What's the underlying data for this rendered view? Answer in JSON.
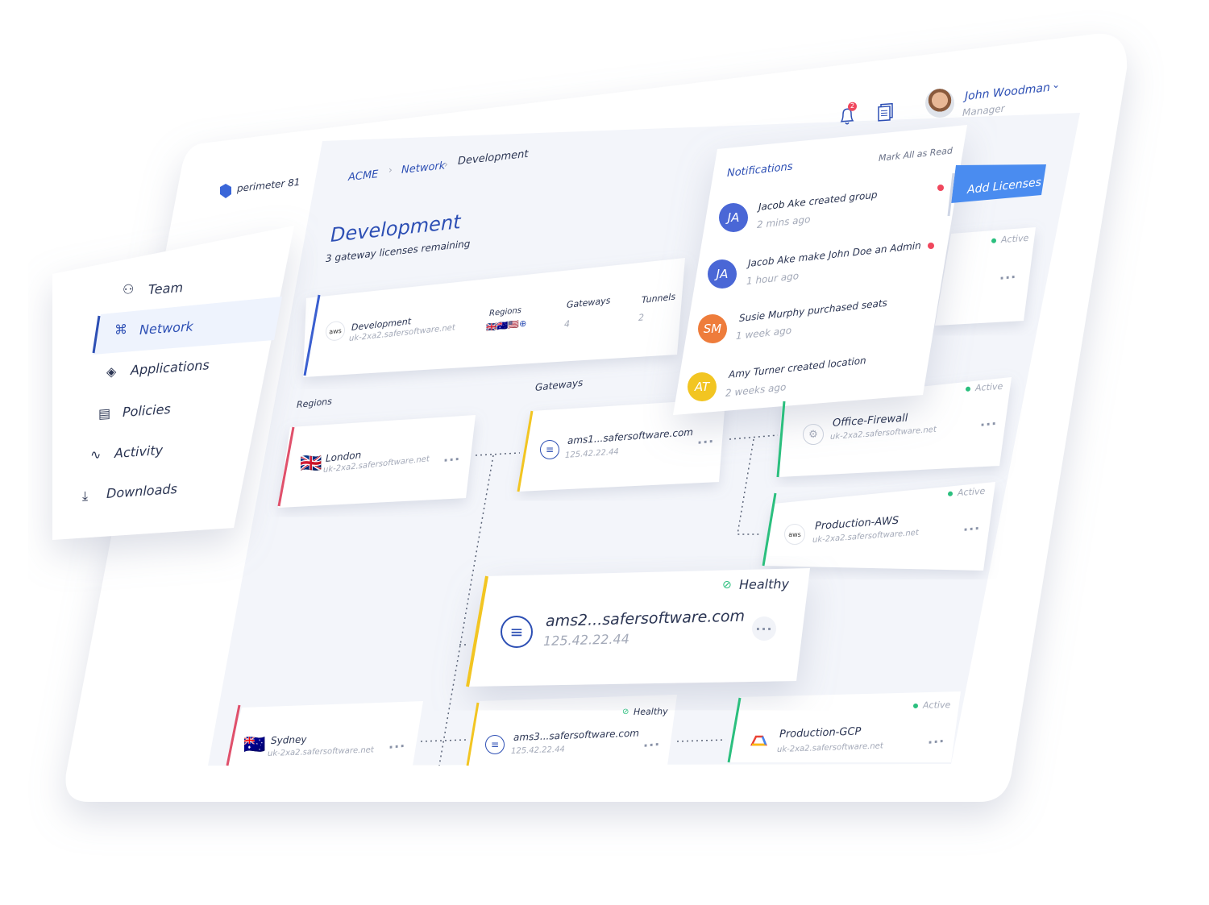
{
  "header": {
    "user_name": "John Woodman",
    "user_role": "Manager",
    "notification_count": "2"
  },
  "logo": "perimeter 81",
  "breadcrumb": [
    "ACME",
    "Network",
    "Development"
  ],
  "page": {
    "title": "Development",
    "subtitle": "3 gateway licenses remaining",
    "add_button": "Add Licenses"
  },
  "sidebar": {
    "items": [
      {
        "label": "Team",
        "icon": "team-icon"
      },
      {
        "label": "Network",
        "icon": "network-icon",
        "active": true
      },
      {
        "label": "Applications",
        "icon": "layers-icon"
      },
      {
        "label": "Policies",
        "icon": "policies-icon"
      },
      {
        "label": "Activity",
        "icon": "activity-icon"
      },
      {
        "label": "Downloads",
        "icon": "download-icon"
      }
    ]
  },
  "summary": {
    "name": "Development",
    "host": "uk-2xa2.safersoftware.net",
    "provider": "aws",
    "regions_label": "Regions",
    "gateways_label": "Gateways",
    "gateways": "4",
    "tunnels_label": "Tunnels",
    "tunnels": "2"
  },
  "sections": {
    "regions": "Regions",
    "gateways": "Gateways"
  },
  "regions": [
    {
      "name": "London",
      "host": "uk-2xa2.safersoftware.net"
    },
    {
      "name": "Sydney",
      "host": "uk-2xa2.safersoftware.net"
    }
  ],
  "gateways": [
    {
      "name": "ams1...safersoftware.com",
      "ip": "125.42.22.44"
    },
    {
      "name": "ams2...safersoftware.com",
      "ip": "125.42.22.44",
      "status": "Healthy"
    },
    {
      "name": "ams3...safersoftware.com",
      "ip": "125.42.22.44",
      "status": "Healthy"
    }
  ],
  "sites": [
    {
      "name": "Office-Firewall",
      "host": "uk-2xa2.safersoftware.net",
      "status": "Active"
    },
    {
      "name": "Production-AWS",
      "host": "uk-2xa2.safersoftware.net",
      "status": "Active",
      "provider": "aws"
    },
    {
      "name": "Production-GCP",
      "host": "uk-2xa2.safersoftware.net",
      "status": "Active"
    },
    {
      "status": "Active"
    }
  ],
  "notifications": {
    "title": "Notifications",
    "mark_all": "Mark All as Read",
    "items": [
      {
        "initials": "JA",
        "name": "Jacob Ake",
        "action": "created group",
        "time": "2 mins ago",
        "color": "#4a67d6",
        "unread": true
      },
      {
        "initials": "JA",
        "name": "Jacob Ake",
        "action": "make John Doe an Admin",
        "time": "1 hour ago",
        "color": "#4a67d6",
        "unread": true
      },
      {
        "initials": "SM",
        "name": "Susie Murphy",
        "action": "purchased seats",
        "time": "1 week ago",
        "color": "#ee7c3b",
        "unread": false
      },
      {
        "initials": "AT",
        "name": "Amy Turner",
        "action": "created location",
        "time": "2 weeks ago",
        "color": "#f2c522",
        "unread": false
      }
    ]
  },
  "colors": {
    "accent": "#2d4fb4",
    "button": "#4a8cf0",
    "active": "#2bbf7e",
    "unread": "#f0475d"
  }
}
